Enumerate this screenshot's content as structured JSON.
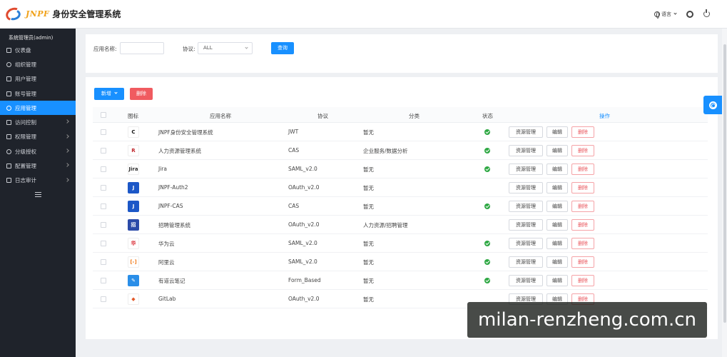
{
  "header": {
    "brand": "JNPF",
    "title": "身份安全管理系统",
    "language_label": "语言",
    "icons": [
      "globe-icon",
      "chevron-down-icon",
      "gear-icon",
      "power-icon"
    ]
  },
  "sidebar": {
    "user": "系统管理员(admin)",
    "items": [
      {
        "label": "仪表盘",
        "icon": "home-icon",
        "expandable": false
      },
      {
        "label": "组织管理",
        "icon": "org-icon",
        "expandable": false
      },
      {
        "label": "用户管理",
        "icon": "user-icon",
        "expandable": false
      },
      {
        "label": "账号管理",
        "icon": "account-icon",
        "expandable": false
      },
      {
        "label": "应用管理",
        "icon": "app-icon",
        "expandable": false,
        "active": true
      },
      {
        "label": "访问控制",
        "icon": "access-icon",
        "expandable": true
      },
      {
        "label": "权限管理",
        "icon": "permission-icon",
        "expandable": true
      },
      {
        "label": "分级授权",
        "icon": "grade-icon",
        "expandable": true
      },
      {
        "label": "配置管理",
        "icon": "config-icon",
        "expandable": true
      },
      {
        "label": "日志审计",
        "icon": "log-icon",
        "expandable": true
      }
    ]
  },
  "search": {
    "app_name_label": "应用名称:",
    "app_name_value": "",
    "protocol_label": "协议:",
    "protocol_value": "ALL",
    "query_button": "查询"
  },
  "toolbar": {
    "add_button": "新增",
    "delete_button": "删除"
  },
  "table": {
    "columns": {
      "icon": "图标",
      "name": "应用名称",
      "protocol": "协议",
      "category": "分类",
      "status": "状态",
      "operations": "操作"
    },
    "action_labels": {
      "resource": "资源管理",
      "edit": "编辑",
      "delete": "删除"
    },
    "rows": [
      {
        "name": "JNPF身份安全管理系统",
        "protocol": "JWT",
        "category": "暂无",
        "enabled": true,
        "icon_text": "C",
        "icon_bg": "#ffffff",
        "icon_color": "#111111"
      },
      {
        "name": "人力资源管理系统",
        "protocol": "CAS",
        "category": "企业服务/数据分析",
        "enabled": true,
        "icon_text": "R",
        "icon_bg": "#ffffff",
        "icon_color": "#c0282d"
      },
      {
        "name": "Jira",
        "protocol": "SAML_v2.0",
        "category": "暂无",
        "enabled": true,
        "icon_text": "Jira",
        "icon_bg": "#ffffff",
        "icon_color": "#333333"
      },
      {
        "name": "JNPF-Auth2",
        "protocol": "OAuth_v2.0",
        "category": "暂无",
        "enabled": false,
        "icon_text": "J",
        "icon_bg": "#1c57c7",
        "icon_color": "#ffffff"
      },
      {
        "name": "JNPF-CAS",
        "protocol": "CAS",
        "category": "暂无",
        "enabled": true,
        "icon_text": "J",
        "icon_bg": "#1c57c7",
        "icon_color": "#ffffff"
      },
      {
        "name": "招聘管理系统",
        "protocol": "OAuth_v2.0",
        "category": "人力资源/招聘管理",
        "enabled": false,
        "icon_text": "招",
        "icon_bg": "#2b4aa8",
        "icon_color": "#ffffff"
      },
      {
        "name": "华为云",
        "protocol": "SAML_v2.0",
        "category": "暂无",
        "enabled": true,
        "icon_text": "华",
        "icon_bg": "#ffffff",
        "icon_color": "#d8252d"
      },
      {
        "name": "阿里云",
        "protocol": "SAML_v2.0",
        "category": "暂无",
        "enabled": true,
        "icon_text": "[-]",
        "icon_bg": "#ffffff",
        "icon_color": "#f07b1a"
      },
      {
        "name": "有道云笔记",
        "protocol": "Form_Based",
        "category": "暂无",
        "enabled": true,
        "icon_text": "✎",
        "icon_bg": "#2a8ee8",
        "icon_color": "#ffffff"
      },
      {
        "name": "GitLab",
        "protocol": "OAuth_v2.0",
        "category": "暂无",
        "enabled": false,
        "icon_text": "◆",
        "icon_bg": "#ffffff",
        "icon_color": "#e2592a"
      }
    ]
  },
  "watermark": "milan-renzheng.com.cn",
  "colors": {
    "primary": "#1890ff",
    "danger": "#f05b60",
    "sidebar": "#1f232b",
    "success": "#2ea843"
  }
}
